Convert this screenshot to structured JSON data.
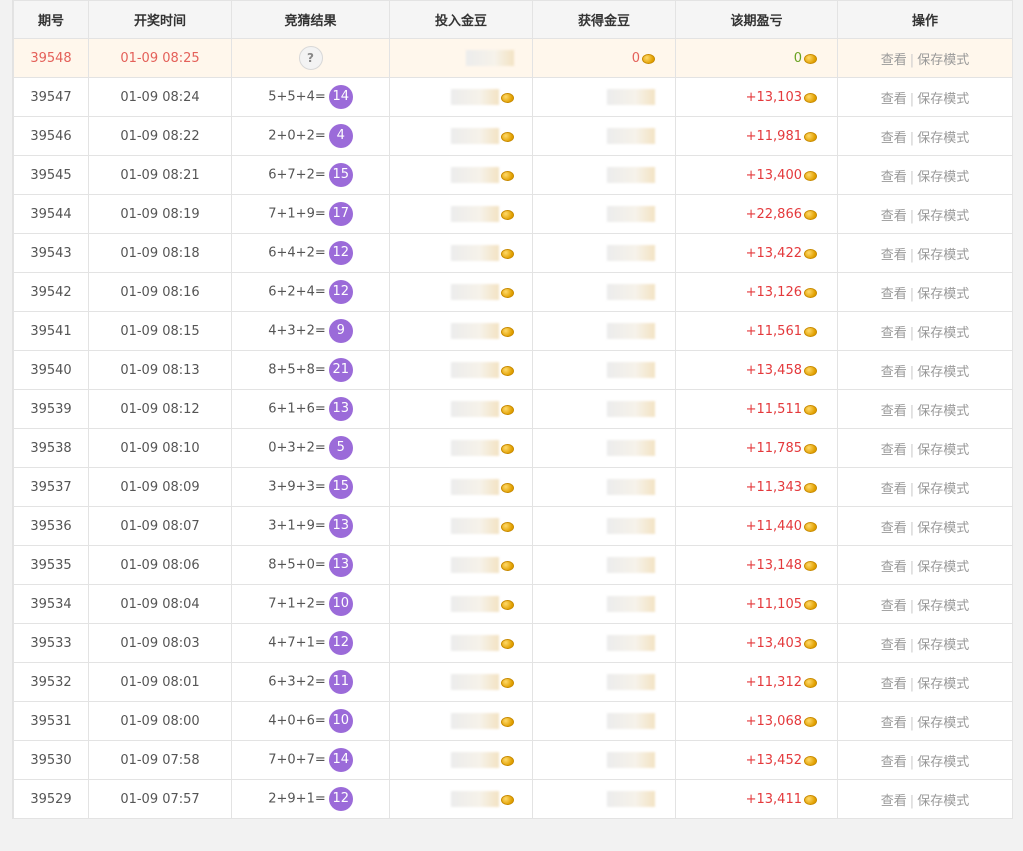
{
  "headers": [
    "期号",
    "开奖时间",
    "竞猜结果",
    "投入金豆",
    "获得金豆",
    "该期盈亏",
    "操作"
  ],
  "pending": {
    "period": "39548",
    "time": "01-09 08:25",
    "result": "?",
    "gain": "0",
    "profit": "0"
  },
  "ops": {
    "view": "查看",
    "save": "保存模式"
  },
  "rows": [
    {
      "period": "39547",
      "time": "01-09 08:24",
      "expr": "5+5+4=",
      "sum": "14",
      "profit": "+13,103"
    },
    {
      "period": "39546",
      "time": "01-09 08:22",
      "expr": "2+0+2=",
      "sum": "4",
      "profit": "+11,981"
    },
    {
      "period": "39545",
      "time": "01-09 08:21",
      "expr": "6+7+2=",
      "sum": "15",
      "profit": "+13,400"
    },
    {
      "period": "39544",
      "time": "01-09 08:19",
      "expr": "7+1+9=",
      "sum": "17",
      "profit": "+22,866"
    },
    {
      "period": "39543",
      "time": "01-09 08:18",
      "expr": "6+4+2=",
      "sum": "12",
      "profit": "+13,422"
    },
    {
      "period": "39542",
      "time": "01-09 08:16",
      "expr": "6+2+4=",
      "sum": "12",
      "profit": "+13,126"
    },
    {
      "period": "39541",
      "time": "01-09 08:15",
      "expr": "4+3+2=",
      "sum": "9",
      "profit": "+11,561"
    },
    {
      "period": "39540",
      "time": "01-09 08:13",
      "expr": "8+5+8=",
      "sum": "21",
      "profit": "+13,458"
    },
    {
      "period": "39539",
      "time": "01-09 08:12",
      "expr": "6+1+6=",
      "sum": "13",
      "profit": "+11,511"
    },
    {
      "period": "39538",
      "time": "01-09 08:10",
      "expr": "0+3+2=",
      "sum": "5",
      "profit": "+11,785"
    },
    {
      "period": "39537",
      "time": "01-09 08:09",
      "expr": "3+9+3=",
      "sum": "15",
      "profit": "+11,343"
    },
    {
      "period": "39536",
      "time": "01-09 08:07",
      "expr": "3+1+9=",
      "sum": "13",
      "profit": "+11,440"
    },
    {
      "period": "39535",
      "time": "01-09 08:06",
      "expr": "8+5+0=",
      "sum": "13",
      "profit": "+13,148"
    },
    {
      "period": "39534",
      "time": "01-09 08:04",
      "expr": "7+1+2=",
      "sum": "10",
      "profit": "+11,105"
    },
    {
      "period": "39533",
      "time": "01-09 08:03",
      "expr": "4+7+1=",
      "sum": "12",
      "profit": "+13,403"
    },
    {
      "period": "39532",
      "time": "01-09 08:01",
      "expr": "6+3+2=",
      "sum": "11",
      "profit": "+11,312"
    },
    {
      "period": "39531",
      "time": "01-09 08:00",
      "expr": "4+0+6=",
      "sum": "10",
      "profit": "+13,068"
    },
    {
      "period": "39530",
      "time": "01-09 07:58",
      "expr": "7+0+7=",
      "sum": "14",
      "profit": "+13,452"
    },
    {
      "period": "39529",
      "time": "01-09 07:57",
      "expr": "2+9+1=",
      "sum": "12",
      "profit": "+13,411"
    }
  ],
  "colors": {
    "profit": "#e4393c",
    "ball": "#9b6bd9",
    "pending_bg": "#fff7ec",
    "pending_text": "#e4615a",
    "zero_profit": "#6aa221"
  }
}
